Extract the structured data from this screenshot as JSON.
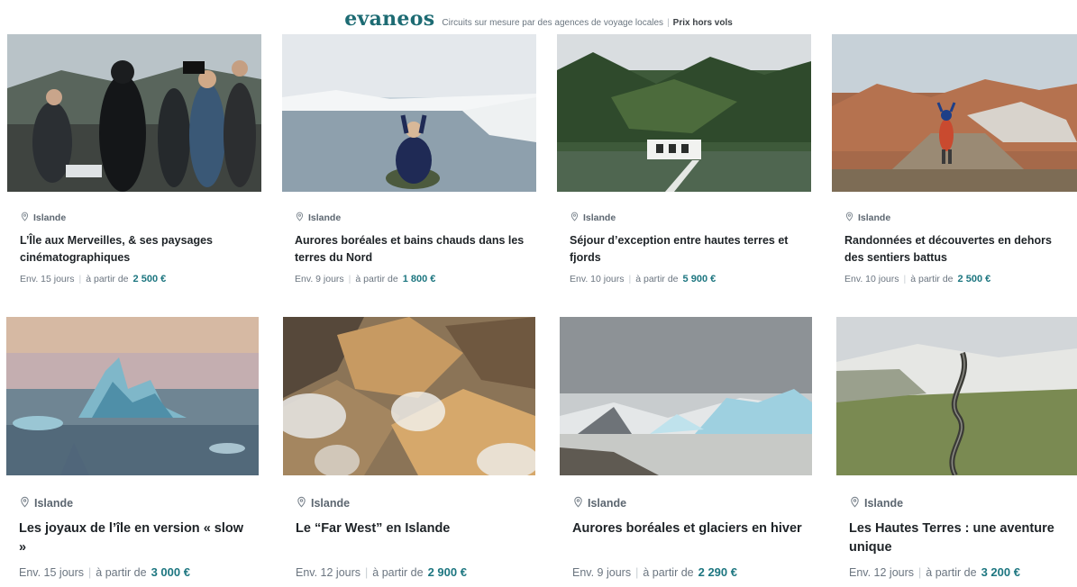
{
  "header": {
    "logo": "evaneos",
    "tagline": "Circuits sur mesure par des agences de voyage locales",
    "separator": "|",
    "tagline_strong": "Prix hors vols"
  },
  "colors": {
    "brand": "#1d6b73",
    "price": "#1d7680"
  },
  "cards": [
    {
      "country": "Islande",
      "title": "L’Île aux Merveilles, & ses paysages cinématographiques",
      "duration": "Env. 15 jours",
      "price_prefix": "à partir de",
      "price": "2 500 €",
      "image": "film-crew-volcanic-landscape"
    },
    {
      "country": "Islande",
      "title": "Aurores boréales et bains chauds dans les terres du Nord",
      "duration": "Env. 9 jours",
      "price_prefix": "à partir de",
      "price": "1 800 €",
      "image": "person-sitting-by-fjord"
    },
    {
      "country": "Islande",
      "title": "Séjour d’exception entre hautes terres et fjords",
      "duration": "Env. 10 jours",
      "price_prefix": "à partir de",
      "price": "5 900 €",
      "image": "hot-pool-in-green-valley"
    },
    {
      "country": "Islande",
      "title": "Randonnées et découvertes en dehors des sentiers battus",
      "duration": "Env. 10 jours",
      "price_prefix": "à partir de",
      "price": "2 500 €",
      "image": "hiker-on-rhyolite-mountains"
    },
    {
      "country": "Islande",
      "title": "Les joyaux de l’île en version « slow »",
      "duration": "Env. 15 jours",
      "price_prefix": "à partir de",
      "price": "3 000 €",
      "image": "iceberg-at-sunset"
    },
    {
      "country": "Islande",
      "title": "Le “Far West” en Islande",
      "duration": "Env. 12 jours",
      "price_prefix": "à partir de",
      "price": "2 900 €",
      "image": "colorful-mountains-with-steam"
    },
    {
      "country": "Islande",
      "title": "Aurores boréales et glaciers en hiver",
      "duration": "Env. 9 jours",
      "price_prefix": "à partir de",
      "price": "2 290 €",
      "image": "glacier-lagoon-icebergs"
    },
    {
      "country": "Islande",
      "title": "Les Hautes Terres : une aventure unique",
      "duration": "Env. 12 jours",
      "price_prefix": "à partir de",
      "price": "3 200 €",
      "image": "road-through-highlands"
    }
  ]
}
